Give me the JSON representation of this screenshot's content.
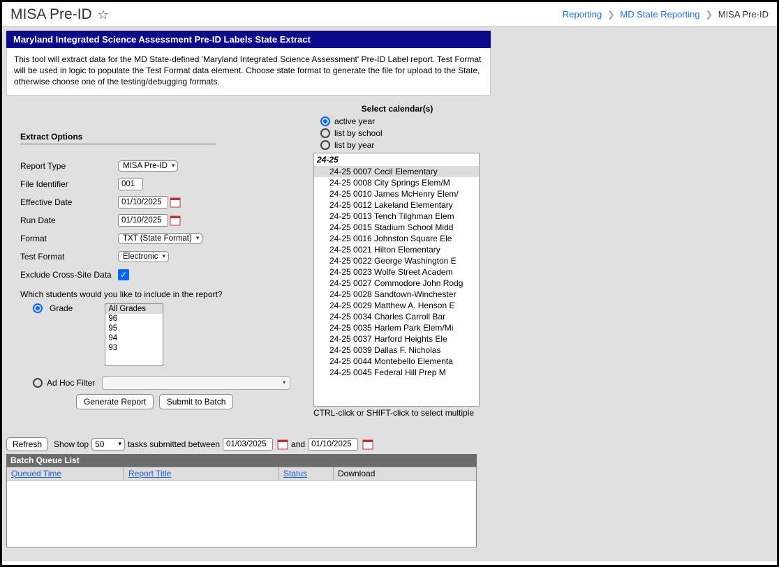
{
  "header": {
    "title": "MISA Pre-ID",
    "breadcrumb": {
      "link1": "Reporting",
      "link2": "MD State Reporting",
      "current": "MISA Pre-ID"
    }
  },
  "subtitle": "Maryland Integrated Science Assessment Pre-ID Labels State Extract",
  "description": "This tool will extract data for the MD State-defined 'Maryland Integrated Science Assessment' Pre-ID Label report. Test Format will be used in logic to populate the Test Format data element. Choose state format to generate the file for upload to the State, otherwise choose one of the testing/debugging formats.",
  "extract": {
    "section_label": "Extract Options",
    "report_type_label": "Report Type",
    "report_type_value": "MISA Pre-ID",
    "file_identifier_label": "File Identifier",
    "file_identifier_value": "001",
    "effective_date_label": "Effective Date",
    "effective_date_value": "01/10/2025",
    "run_date_label": "Run Date",
    "run_date_value": "01/10/2025",
    "format_label": "Format",
    "format_value": "TXT (State Format)",
    "test_format_label": "Test Format",
    "test_format_value": "Electronic",
    "exclude_label": "Exclude Cross-Site Data",
    "question": "Which students would you like to include in the report?",
    "grade_label": "Grade",
    "grades": [
      "All Grades",
      "96",
      "95",
      "94",
      "93"
    ],
    "adhoc_label": "Ad Hoc Filter",
    "generate_btn": "Generate Report",
    "submit_btn": "Submit to Batch"
  },
  "calendars": {
    "label": "Select calendar(s)",
    "radios": {
      "active": "active year",
      "school": "list by school",
      "year": "list by year"
    },
    "year_header": "24-25",
    "items": [
      "24-25 0007 Cecil Elementary",
      "24-25 0008 City Springs Elem/M",
      "24-25 0010 James McHenry Elem/",
      "24-25 0012 Lakeland Elementary",
      "24-25 0013 Tench Tilghman Elem",
      "24-25 0015 Stadium School Midd",
      "24-25 0016 Johnston Square Ele",
      "24-25 0021 Hilton Elementary",
      "24-25 0022 George Washington E",
      "24-25 0023 Wolfe Street Academ",
      "24-25 0027 Commodore John Rodg",
      "24-25 0028 Sandtown-Winchester",
      "24-25 0029 Matthew A. Henson E",
      "24-25 0034 Charles Carroll Bar",
      "24-25 0035 Harlem Park Elem/Mi",
      "24-25 0037 Harford Heights Ele",
      "24-25 0039 Dallas F. Nicholas",
      "24-25 0044 Montebello Elementa",
      "24-25 0045 Federal Hill Prep M"
    ],
    "hint": "CTRL-click or SHIFT-click to select multiple"
  },
  "batch": {
    "refresh": "Refresh",
    "showtop_pre": "Show top",
    "showtop_value": "50",
    "showtop_post": "tasks submitted between",
    "date1": "01/03/2025",
    "and": "and",
    "date2": "01/10/2025",
    "header": "Batch Queue List",
    "cols": {
      "queued": "Queued Time",
      "report": "Report Title",
      "status": "Status",
      "download": "Download"
    }
  }
}
